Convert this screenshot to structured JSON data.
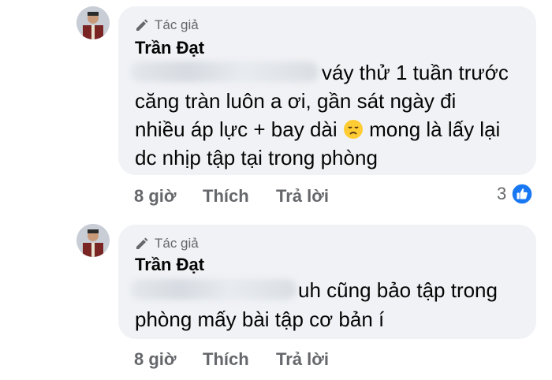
{
  "comments": [
    {
      "badge": "Tác giả",
      "author": "Trần Đạt",
      "lines": [
        "váy thử 1 tuần trước",
        "căng tràn luôn a ơi, gần sát ngày đi",
        "nhiều áp lực + bay dài",
        "mong là lấy lại",
        "dc nhịp tập tại trong phòng"
      ],
      "time": "8 giờ",
      "like_label": "Thích",
      "reply_label": "Trả lời",
      "reaction_count": "3"
    },
    {
      "badge": "Tác giả",
      "author": "Trần Đạt",
      "lines": [
        "uh cũng bảo tập trong",
        "phòng mấy bài tập cơ bản í"
      ],
      "time": "8 giờ",
      "like_label": "Thích",
      "reply_label": "Trả lời"
    }
  ],
  "colors": {
    "bubble": "#f0f2f5",
    "meta_text": "#65676b",
    "like_blue": "#1877f2"
  },
  "icons": [
    "pencil-icon",
    "disappointed-face-emoji",
    "like-reaction-icon"
  ]
}
